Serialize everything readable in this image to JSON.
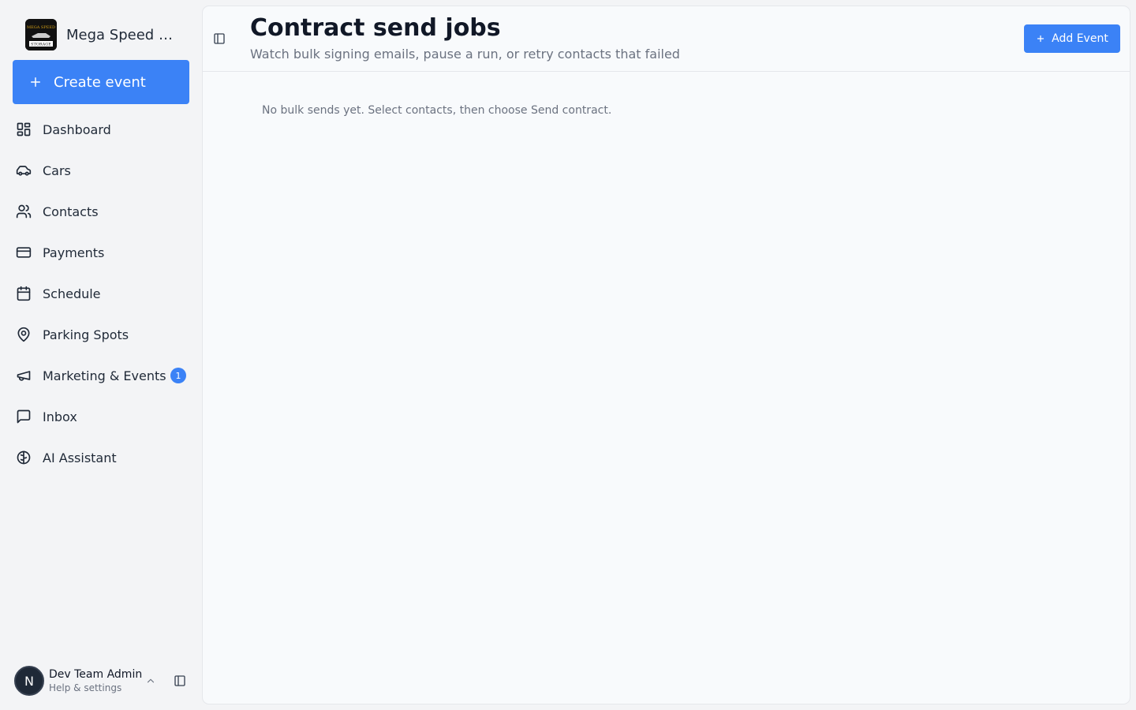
{
  "brand": {
    "name": "Mega Speed St...",
    "logo_text_top": "MEGA SPEED",
    "logo_text_bottom": "STORAGE"
  },
  "sidebar": {
    "create_label": "Create event",
    "items": [
      {
        "label": "Dashboard",
        "icon": "dashboard-icon"
      },
      {
        "label": "Cars",
        "icon": "car-icon"
      },
      {
        "label": "Contacts",
        "icon": "users-icon"
      },
      {
        "label": "Payments",
        "icon": "credit-card-icon"
      },
      {
        "label": "Schedule",
        "icon": "calendar-icon"
      },
      {
        "label": "Parking Spots",
        "icon": "map-pin-icon"
      },
      {
        "label": "Marketing & Events",
        "icon": "megaphone-icon",
        "badge": "1"
      },
      {
        "label": "Inbox",
        "icon": "message-square-icon"
      },
      {
        "label": "AI Assistant",
        "icon": "brain-icon"
      }
    ]
  },
  "user": {
    "initial": "N",
    "name": "Dev Team Admin",
    "subtitle": "Help & settings"
  },
  "header": {
    "title": "Contract send jobs",
    "subtitle": "Watch bulk signing emails, pause a run, or retry contacts that failed",
    "add_label": "Add Event"
  },
  "main": {
    "empty_message": "No bulk sends yet. Select contacts, then choose Send contract."
  },
  "colors": {
    "accent": "#3b82f6",
    "sidebar_bg": "#f3f4f6",
    "panel_bg": "#f8fafc"
  }
}
